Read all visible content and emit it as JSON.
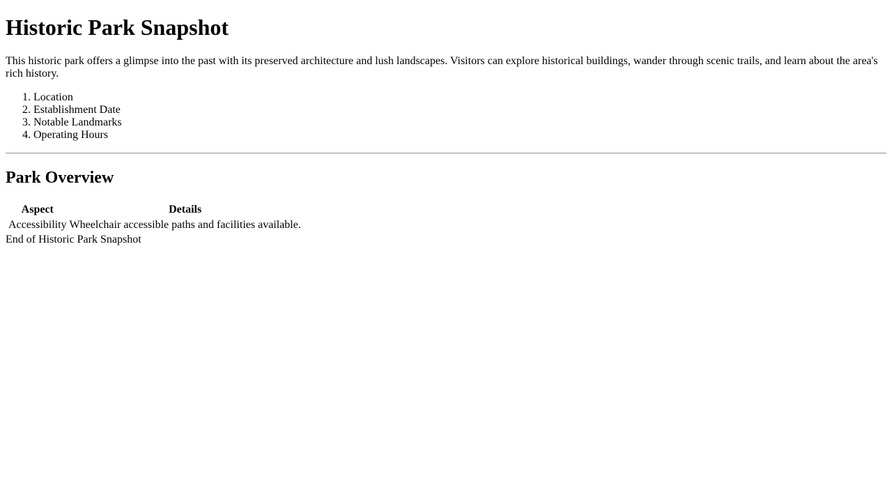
{
  "page": {
    "title": "Historic Park Snapshot",
    "intro": "This historic park offers a glimpse into the past with its preserved architecture and lush landscapes. Visitors can explore historical buildings, wander through scenic trails, and learn about the area's rich history."
  },
  "topics": [
    "Location",
    "Establishment Date",
    "Notable Landmarks",
    "Operating Hours"
  ],
  "overview": {
    "heading": "Park Overview",
    "columns": [
      "Aspect",
      "Details"
    ],
    "rows": [
      [
        "Accessibility",
        "Wheelchair accessible paths and facilities available."
      ]
    ]
  },
  "footer": {
    "text": "End of Historic Park Snapshot"
  }
}
